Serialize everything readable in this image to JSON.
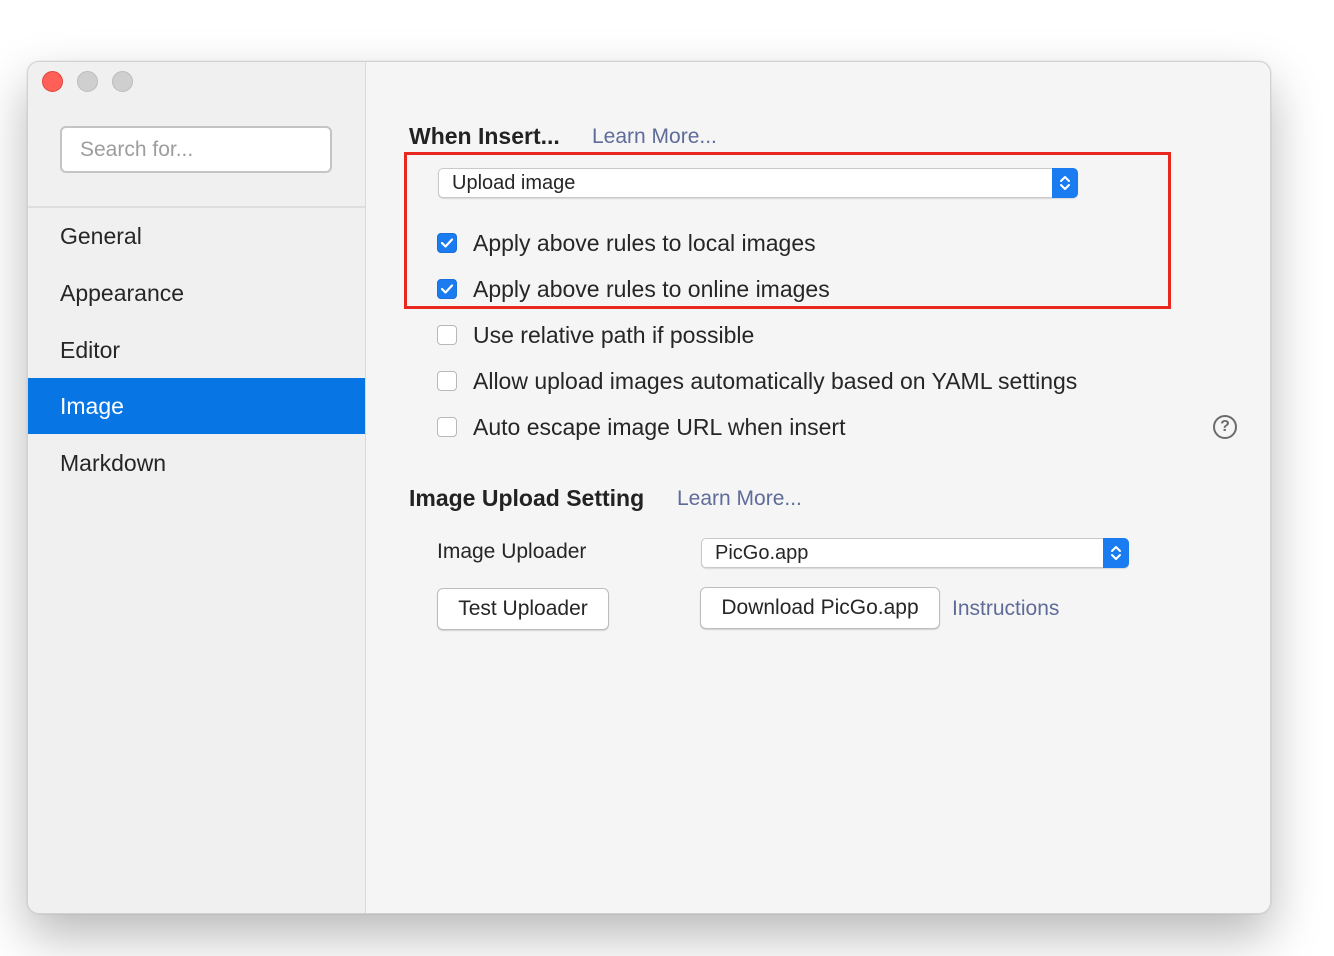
{
  "sidebar": {
    "search_placeholder": "Search for...",
    "items": [
      {
        "label": "General"
      },
      {
        "label": "Appearance"
      },
      {
        "label": "Editor"
      },
      {
        "label": "Image"
      },
      {
        "label": "Markdown"
      }
    ],
    "active_item": "Image"
  },
  "when_insert": {
    "title": "When Insert...",
    "learn_more": "Learn More...",
    "action_value": "Upload image",
    "options": [
      {
        "label": "Apply above rules to local images",
        "checked": true
      },
      {
        "label": "Apply above rules to online images",
        "checked": true
      },
      {
        "label": "Use relative path if possible",
        "checked": false
      },
      {
        "label": "Allow upload images automatically based on YAML settings",
        "checked": false
      },
      {
        "label": "Auto escape image URL when insert",
        "checked": false
      }
    ],
    "help_glyph": "?"
  },
  "upload_setting": {
    "title": "Image Upload Setting",
    "learn_more": "Learn More...",
    "uploader_label": "Image Uploader",
    "uploader_value": "PicGo.app",
    "test_button": "Test Uploader",
    "download_button": "Download PicGo.app",
    "instructions_link": "Instructions"
  },
  "colors": {
    "accent": "#0875e4",
    "highlight_border": "#e8271f",
    "link": "#5f6c99"
  }
}
